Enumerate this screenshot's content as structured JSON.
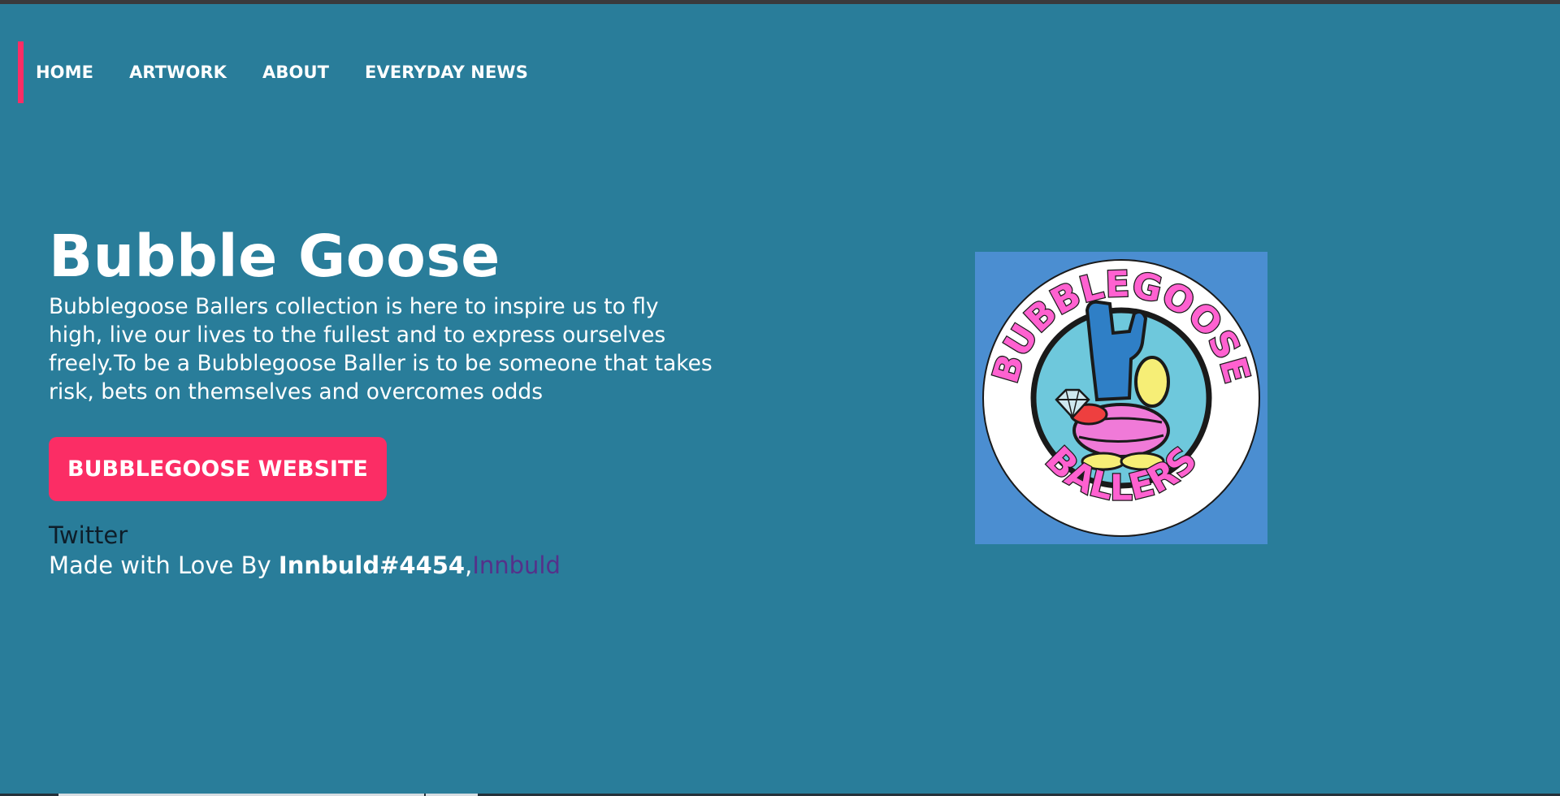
{
  "nav": {
    "items": [
      {
        "label": "HOME"
      },
      {
        "label": "ARTWORK"
      },
      {
        "label": "ABOUT"
      },
      {
        "label": "EVERYDAY NEWS"
      }
    ]
  },
  "hero": {
    "title": "Bubble Goose",
    "description": "Bubblegoose Ballers collection is here to inspire us to fly high, live our lives to the fullest and to express ourselves freely.To be a Bubblegoose Baller is to be someone that takes risk, bets on themselves and overcomes odds",
    "cta_label": "BUBBLEGOOSE WEBSITE"
  },
  "links": {
    "twitter_label": "Twitter",
    "credit_prefix": "Made with Love By ",
    "credit_handle": "Innbuld#4454",
    "credit_separator": ",",
    "credit_name": "Innbuld"
  },
  "logo": {
    "top_text": "BUBBLEGOOSE",
    "bottom_text": "BALLERS"
  },
  "colors": {
    "background": "#297d9a",
    "accent": "#fb2d65",
    "logo_bg": "#4b8ed1",
    "logo_text": "#ff61d0",
    "link": "#55318a"
  }
}
